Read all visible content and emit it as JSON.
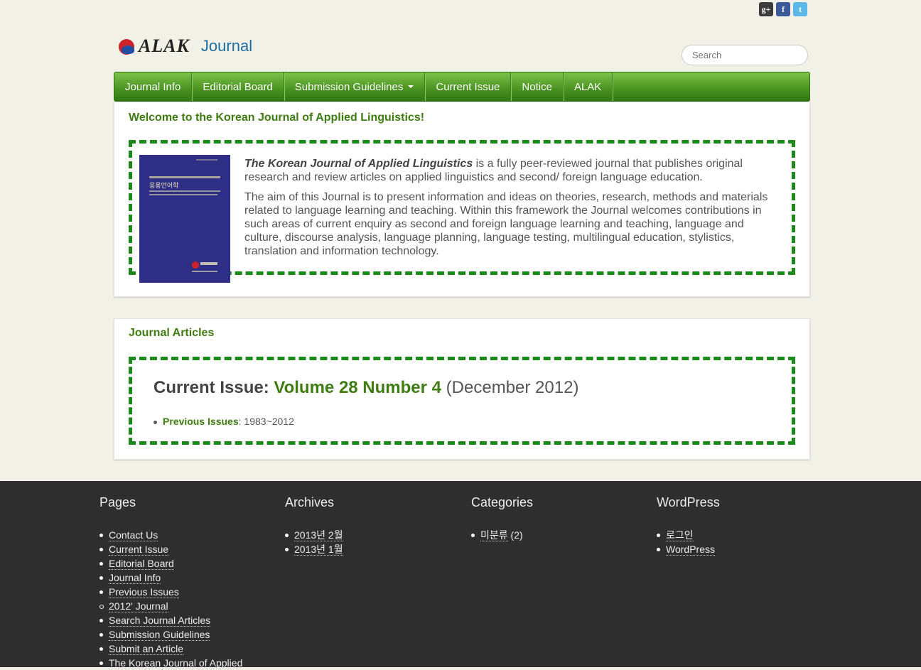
{
  "social": {
    "google": "g+",
    "facebook": "f",
    "twitter": "t"
  },
  "logo": {
    "alak": "ALAK",
    "journal": "Journal"
  },
  "search": {
    "placeholder": "Search"
  },
  "nav": {
    "items": [
      "Journal Info",
      "Editorial Board",
      "Submission Guidelines",
      "Current Issue",
      "Notice",
      "ALAK"
    ]
  },
  "welcome": {
    "title": "Welcome to the Korean Journal of Applied Linguistics!",
    "journal_name": "The Korean Journal of Applied Linguistics",
    "p1_rest": " is a fully peer-reviewed journal that publishes original research and review articles on applied linguistics and second/ foreign language education.",
    "p2": "The aim of this Journal is to present information and ideas on theories, research, methods and materials related to  language  learning and teaching. Within this framework the Journal welcomes contributions in such areas of current  enquiry as second and foreign language learning and teaching, language and culture, discourse analysis, language planning, language testing, multilingual education, stylistics, translation and information technology.",
    "cover_title": "응용언어학"
  },
  "articles": {
    "title": "Journal Articles",
    "current_label": "Current Issue: ",
    "volume": "Volume 28 Number 4",
    "date": " (December 2012)",
    "previous_link": "Previous Issues",
    "previous_range": ": 1983~2012"
  },
  "footer": {
    "pages": {
      "title": "Pages",
      "items": [
        "Contact Us",
        "Current Issue",
        "Editorial Board",
        "Journal Info",
        "Previous Issues",
        "2012' Journal",
        "Search Journal Articles",
        "Submission Guidelines",
        "Submit an Article",
        "The Korean Journal of Applied"
      ]
    },
    "archives": {
      "title": "Archives",
      "items": [
        "2013년 2월",
        "2013년 1월"
      ]
    },
    "categories": {
      "title": "Categories",
      "item": "미분류",
      "count": " (2)"
    },
    "wordpress": {
      "title": "WordPress",
      "items": [
        "로그인",
        "WordPress"
      ]
    }
  }
}
